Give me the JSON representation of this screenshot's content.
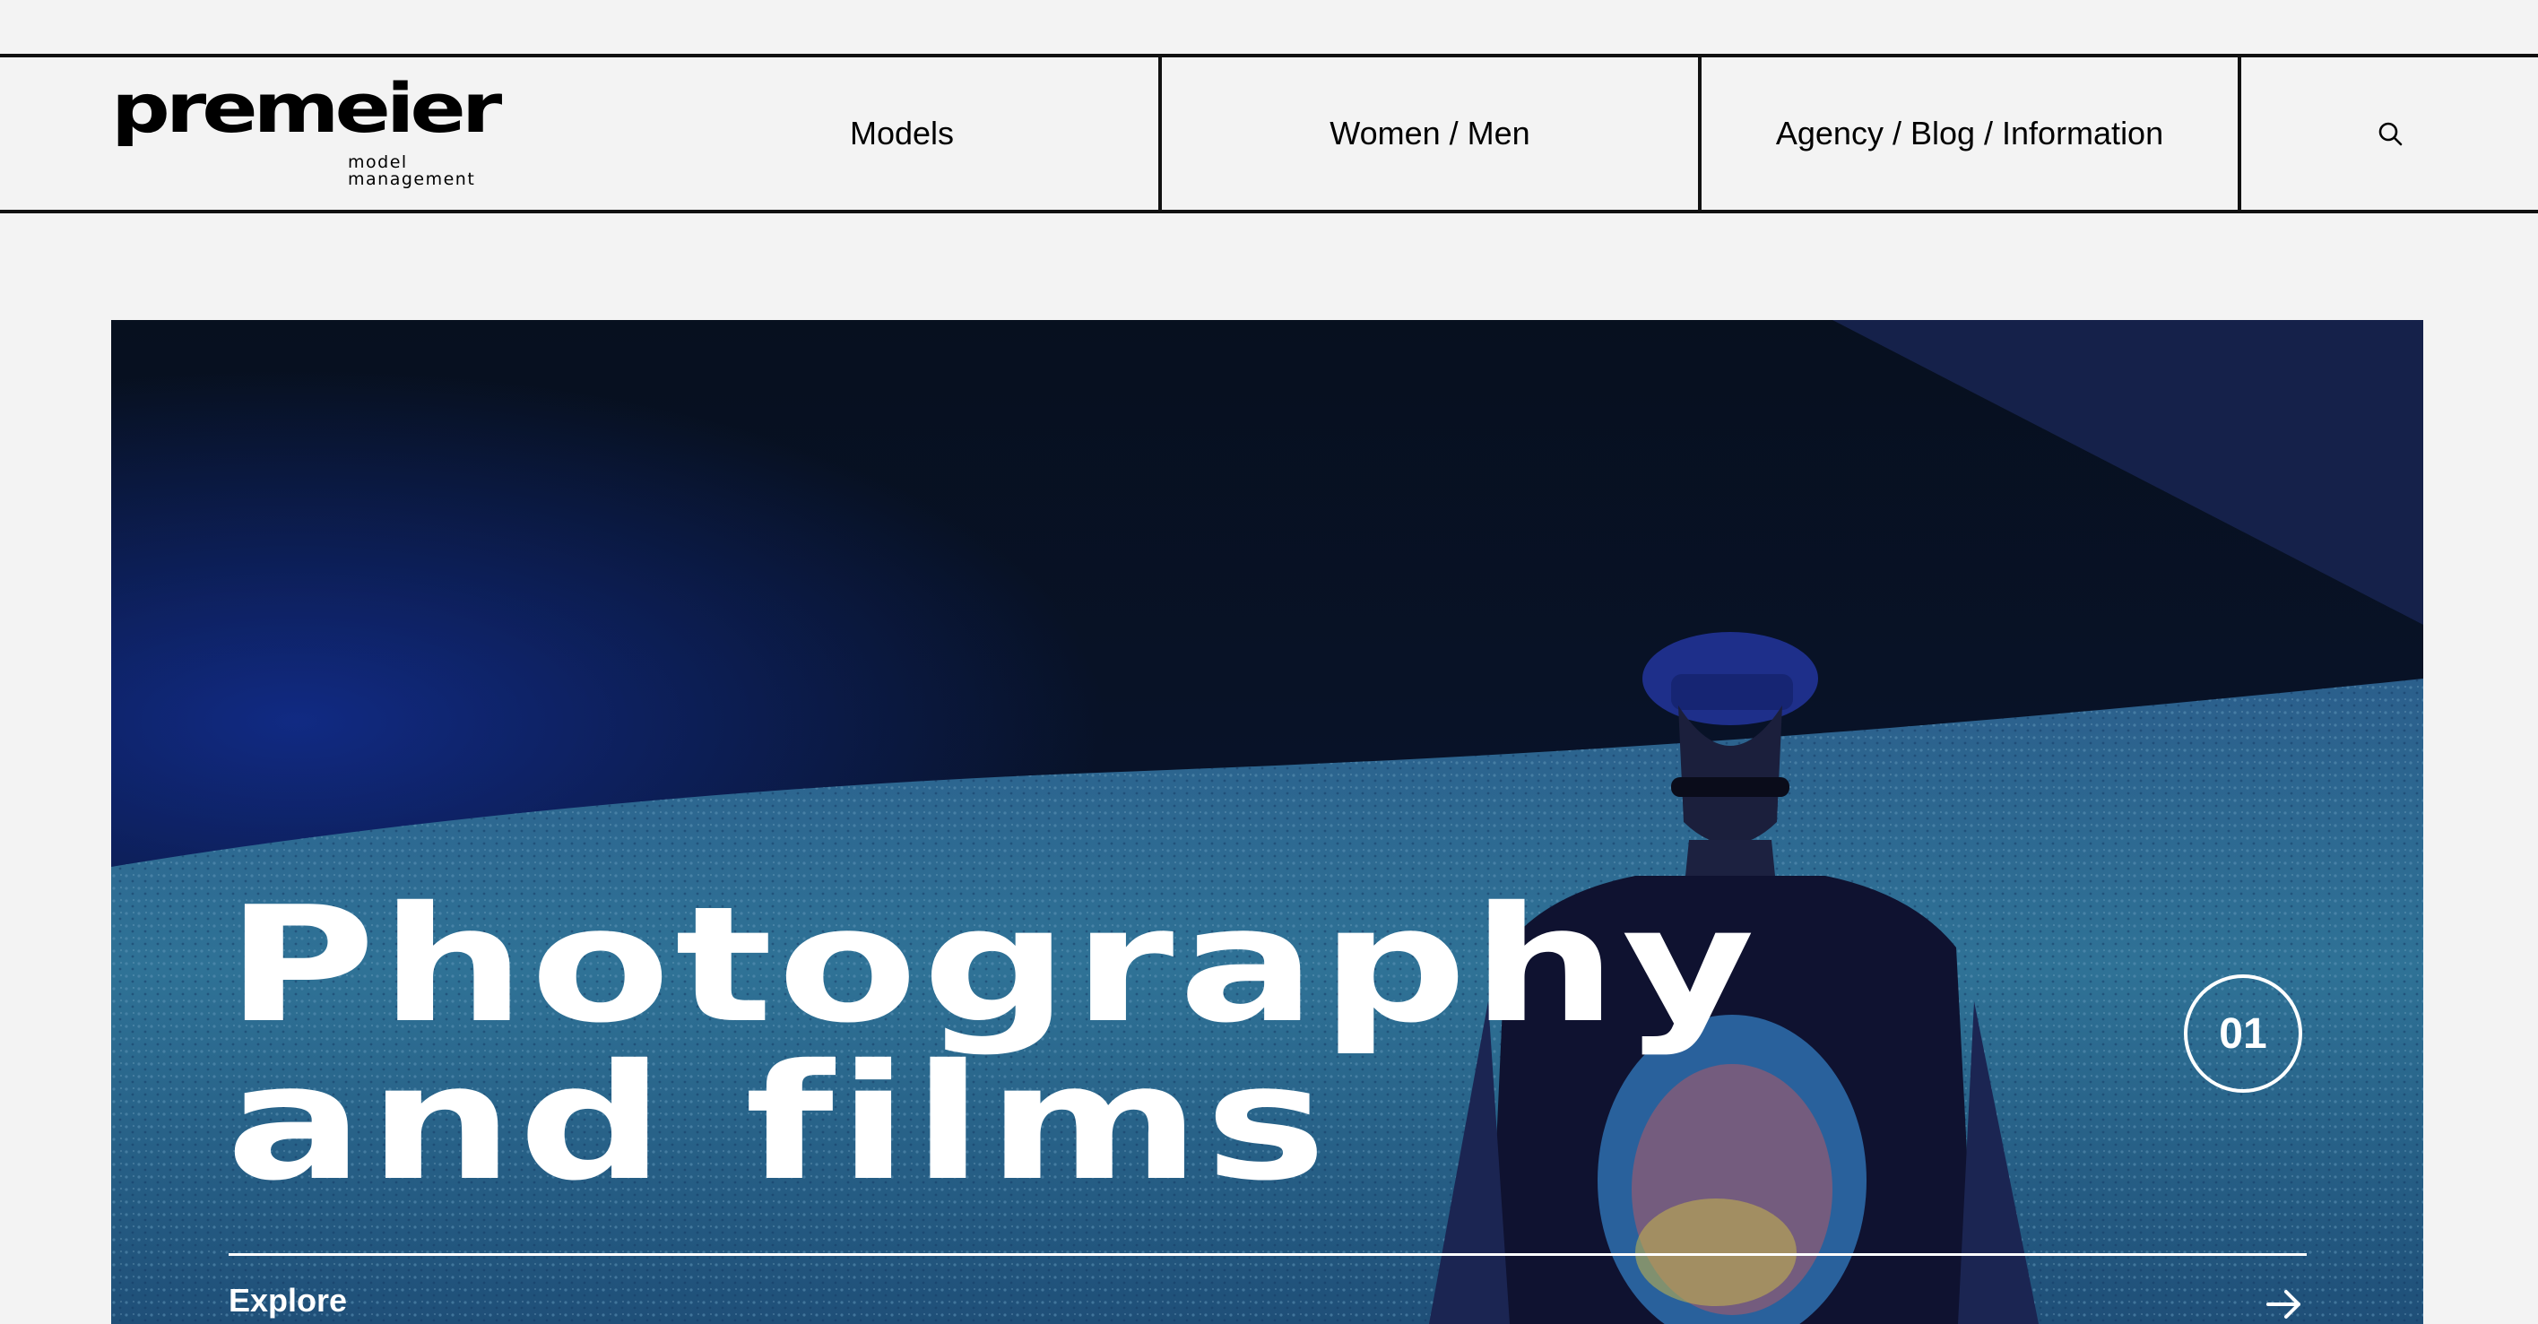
{
  "header": {
    "logo": {
      "main": "premeier",
      "sub": "model management"
    },
    "nav": {
      "models": "Models",
      "women_men": "Women / Men",
      "agency_blog_info": "Agency / Blog / Information"
    },
    "search_icon": "search-icon"
  },
  "hero": {
    "title_line1": "Photography",
    "title_line2": "and films",
    "slide_number": "01",
    "explore_label": "Explore",
    "arrow_icon": "arrow-right-icon"
  },
  "colors": {
    "background": "#f3f3f3",
    "border": "#111111",
    "hero_text": "#ffffff",
    "hero_dark": "#071028",
    "hero_blue": "#2f6d94"
  }
}
